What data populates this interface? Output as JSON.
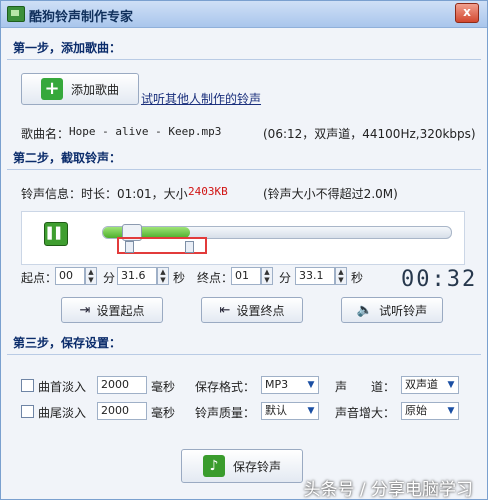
{
  "window": {
    "title": "酷狗铃声制作专家",
    "close_glyph": "x"
  },
  "step1": {
    "title": "第一步，添加歌曲：",
    "add_button": "添加歌曲",
    "others_link": "试听其他人制作的铃声",
    "song_label": "歌曲名：",
    "song_name": "Hope - alive - Keep.mp3",
    "song_info": "(06:12，双声道，44100Hz,320kbps)"
  },
  "step2": {
    "title": "第二步，截取铃声：",
    "info_label": "铃声信息：时长：01:01，大小",
    "size_value": "2403KB",
    "size_hint": "(铃声大小不得超过2.0M)",
    "start_label": "起点：",
    "start_min": "00",
    "start_sec": "31.6",
    "end_label": "终点：",
    "end_min": "01",
    "end_sec": "33.1",
    "minute_unit": "分",
    "second_unit": "秒",
    "timer": "00:32",
    "set_start_button": "设置起点",
    "set_end_button": "设置终点",
    "preview_button": "试听铃声",
    "progress": {
      "handle_fraction": 0.08,
      "fill_end_fraction": 0.25,
      "start_marker_fraction": 0.08,
      "end_marker_fraction": 0.25
    }
  },
  "step3": {
    "title": "第三步，保存设置：",
    "fade_in_label": "曲首淡入",
    "fade_in_value": "2000",
    "fade_out_label": "曲尾淡入",
    "fade_out_value": "2000",
    "ms_unit": "毫秒",
    "format_label": "保存格式：",
    "format_value": "MP3",
    "quality_label": "铃声质量：",
    "quality_value": "默认",
    "channel_label": "声　　道：",
    "channel_value": "双声道",
    "gain_label": "声音增大：",
    "gain_value": "原始",
    "save_button": "保存铃声"
  },
  "watermark": "头条号 / 分享电脑学习",
  "icons": {
    "add": "plus-icon",
    "pause": "pause-icon",
    "start": "start-marker-icon",
    "end": "end-marker-icon",
    "speaker": "speaker-icon",
    "save": "note-icon"
  },
  "colors": {
    "accent_green": "#3f9e30",
    "highlight_red": "#e23b3b",
    "size_red": "#d11414"
  }
}
